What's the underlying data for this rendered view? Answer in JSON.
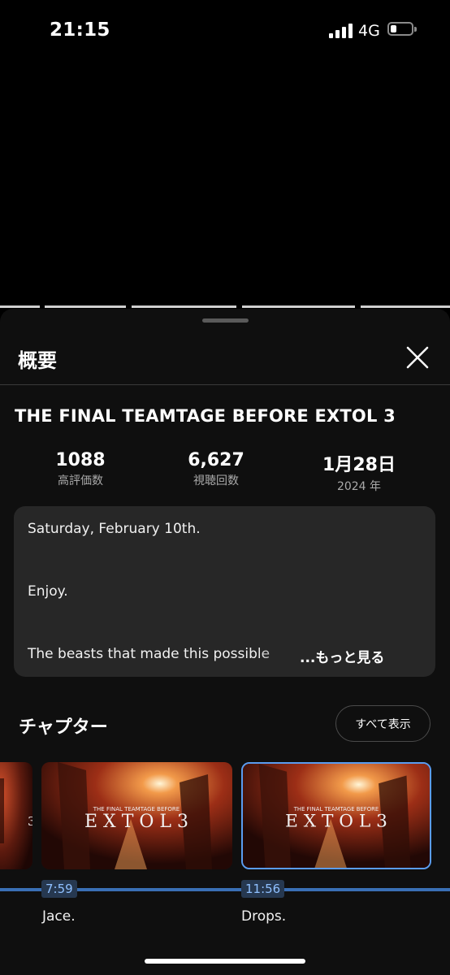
{
  "status": {
    "time": "21:15",
    "network": "4G",
    "battery_level": 0.3
  },
  "player": {
    "segments": 5
  },
  "sheet": {
    "title": "概要",
    "video_title": "THE FINAL TEAMTAGE BEFORE EXTOL 3",
    "stats": [
      {
        "value": "1088",
        "label": "高評価数"
      },
      {
        "value": "6,627",
        "label": "視聴回数"
      },
      {
        "value": "1月28日",
        "label": "2024 年"
      }
    ],
    "description": {
      "lines": [
        "Saturday, February 10th.",
        "Enjoy.",
        "The beasts that made this possible"
      ],
      "more": "...もっと見る"
    },
    "chapters": {
      "title": "チャプター",
      "show_all": "すべて表示",
      "thumb_text_top": "THE FINAL TEAMTAGE BEFORE",
      "thumb_text_main": "E X T O L   3",
      "items": [
        {
          "time": "7:59",
          "name": "Jace."
        },
        {
          "time": "11:56",
          "name": "Drops."
        }
      ]
    }
  },
  "colors": {
    "accent": "#5a9cf0",
    "sheet_bg": "#0f0f0f",
    "card_bg": "#272727"
  }
}
